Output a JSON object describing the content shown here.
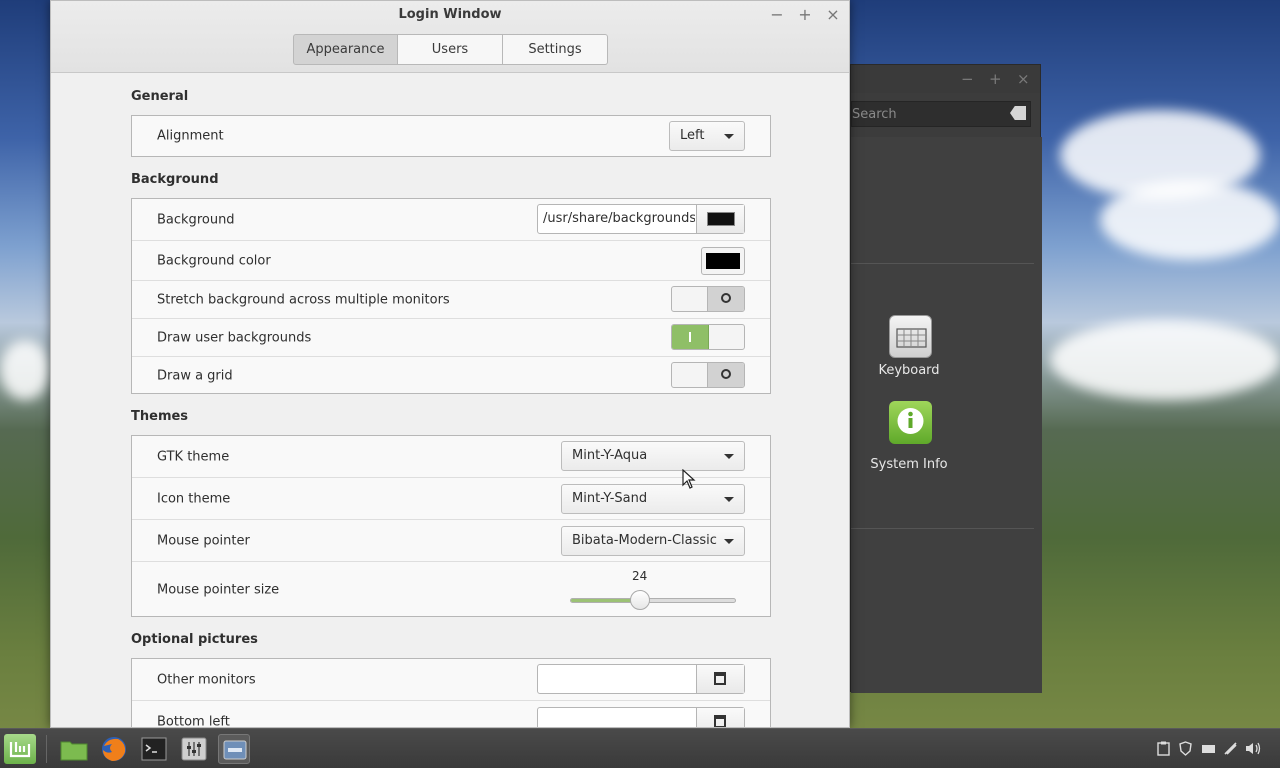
{
  "window": {
    "title": "Login Window",
    "minimize": "−",
    "maximize": "+",
    "close": "×"
  },
  "tabs": [
    "Appearance",
    "Users",
    "Settings"
  ],
  "sections": {
    "general": {
      "title": "General",
      "alignment_label": "Alignment",
      "alignment_value": "Left"
    },
    "background": {
      "title": "Background",
      "background_label": "Background",
      "background_path": "/usr/share/backgrounds/",
      "color_label": "Background color",
      "color_value": "#000000",
      "stretch_label": "Stretch background across multiple monitors",
      "stretch_on": false,
      "user_bg_label": "Draw user backgrounds",
      "user_bg_on": true,
      "grid_label": "Draw a grid",
      "grid_on": false
    },
    "themes": {
      "title": "Themes",
      "gtk_label": "GTK theme",
      "gtk_value": "Mint-Y-Aqua",
      "icon_label": "Icon theme",
      "icon_value": "Mint-Y-Sand",
      "pointer_label": "Mouse pointer",
      "pointer_value": "Bibata-Modern-Classic",
      "pointer_size_label": "Mouse pointer size",
      "pointer_size_value": "24"
    },
    "optional": {
      "title": "Optional pictures",
      "other_monitors_label": "Other monitors",
      "bottom_left_label": "Bottom left"
    }
  },
  "background_window": {
    "search_placeholder": "Search",
    "apps": [
      {
        "label": "Keyboard",
        "icon": "keyboard-icon"
      },
      {
        "label": "System Info",
        "icon": "info-icon"
      }
    ]
  },
  "taskbar": {
    "items": [
      "mint-menu-icon",
      "files-icon",
      "firefox-icon",
      "terminal-icon",
      "settings-icon",
      "login-window-icon"
    ],
    "tray": [
      "clipboard-icon",
      "shield-icon",
      "keyboard-layout-icon",
      "network-icon",
      "volume-icon"
    ]
  },
  "colors": {
    "accent": "#8fbf67"
  }
}
